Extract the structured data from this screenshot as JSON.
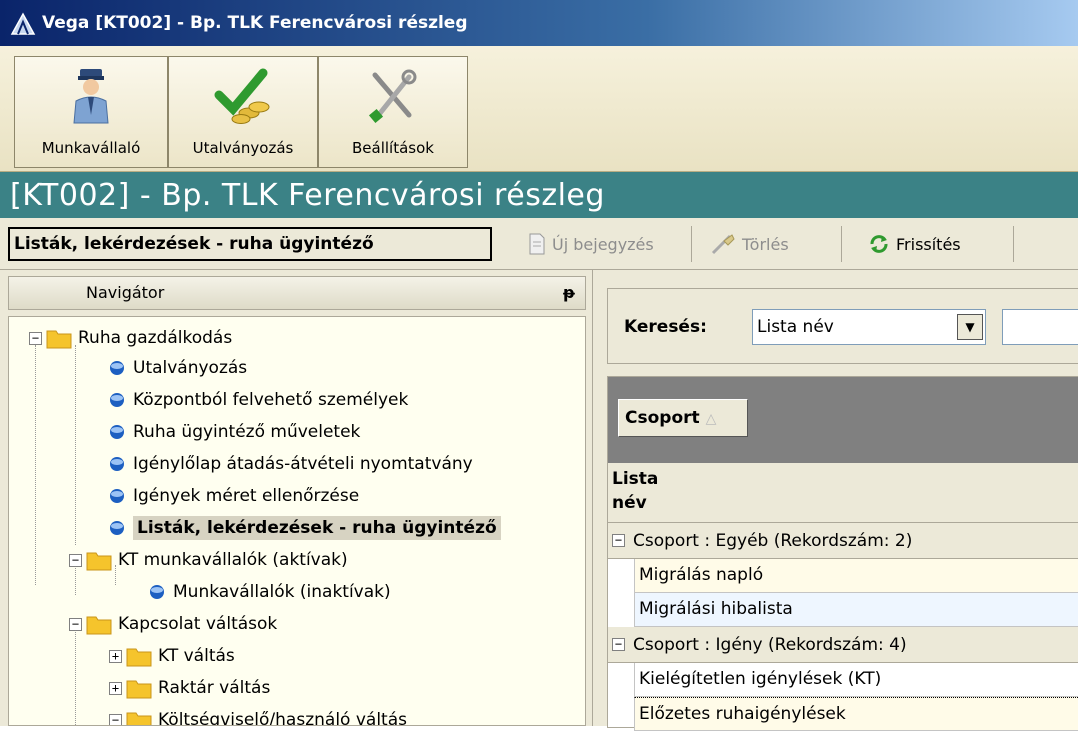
{
  "window": {
    "title": "Vega [KT002] - Bp. TLK Ferencvárosi részleg"
  },
  "toolbar": {
    "buttons": [
      {
        "label": "Munkavállaló",
        "icon": "employee-icon"
      },
      {
        "label": "Utalványozás",
        "icon": "checkmark-coins-icon"
      },
      {
        "label": "Beállítások",
        "icon": "tools-icon"
      }
    ]
  },
  "header": {
    "title": "[KT002] - Bp. TLK Ferencvárosi részleg"
  },
  "actionbar": {
    "context_title": "Listák, lekérdezések - ruha ügyintéző",
    "new_label": "Új bejegyzés",
    "delete_label": "Törlés",
    "refresh_label": "Frissítés"
  },
  "navigator": {
    "title": "Navigátor",
    "pin": "ᵽ",
    "tree": [
      {
        "label": "Ruha gazdálkodás",
        "type": "folder",
        "expander": "−"
      },
      {
        "label": "Utalványozás",
        "type": "leaf"
      },
      {
        "label": "Központból felvehető személyek",
        "type": "leaf"
      },
      {
        "label": "Ruha ügyintéző műveletek",
        "type": "leaf"
      },
      {
        "label": "Igénylőlap átadás-átvételi nyomtatvány",
        "type": "leaf"
      },
      {
        "label": "Igények méret ellenőrzése",
        "type": "leaf"
      },
      {
        "label": "Listák, lekérdezések - ruha ügyintéző",
        "type": "leaf",
        "selected": true
      },
      {
        "label": "KT munkavállalók (aktívak)",
        "type": "folder",
        "expander": "−"
      },
      {
        "label": "Munkavállalók (inaktívak)",
        "type": "leaf"
      },
      {
        "label": "Kapcsolat váltások",
        "type": "folder",
        "expander": "−"
      },
      {
        "label": "KT váltás",
        "type": "folder",
        "expander": "+"
      },
      {
        "label": "Raktár váltás",
        "type": "folder",
        "expander": "+"
      },
      {
        "label": "Költségviselő/használó váltás",
        "type": "folder",
        "expander": "−"
      }
    ]
  },
  "search": {
    "label": "Keresés:",
    "field_value": "Lista név",
    "input_value": ""
  },
  "grid": {
    "group_chip": "Csoport",
    "sort_glyph": "△",
    "column_header": "Lista név",
    "groups": [
      {
        "label": "Csoport : Egyéb (Rekordszám: 2)",
        "rows": [
          "Migrálás napló",
          "Migrálási hibalista"
        ]
      },
      {
        "label": "Csoport : Igény (Rekordszám: 4)",
        "rows": [
          "Kielégítetlen igénylések (KT)",
          "Előzetes ruhaigénylések"
        ]
      }
    ]
  },
  "colors": {
    "header_teal": "#3b8286",
    "toolbar_bg": "#f6f1dc",
    "panel_bg": "#ece9d8",
    "group_bar": "#808080"
  }
}
